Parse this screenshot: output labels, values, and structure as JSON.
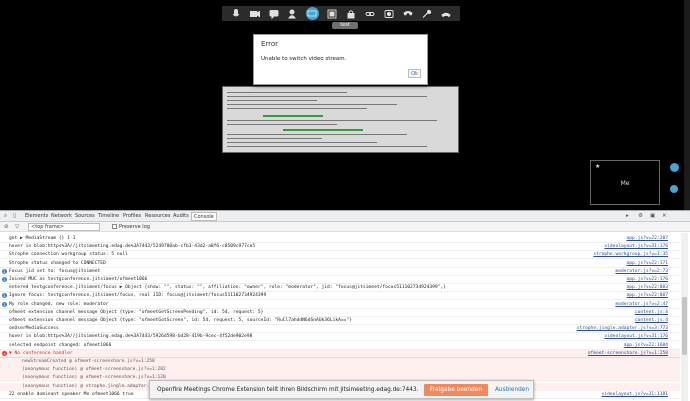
{
  "video": {
    "subject": "test",
    "local_name": "Me",
    "toolbar_icons": [
      "mic-icon",
      "camera-icon",
      "chat-icon",
      "add-user-icon",
      "desktop-share-icon",
      "fullscreen-icon",
      "lock-icon",
      "link-icon",
      "record-icon",
      "phone-icon",
      "settings-icon",
      "hangup-icon"
    ]
  },
  "dialog": {
    "title": "Error",
    "message": "Unable to switch video stream.",
    "ok_label": "Ok"
  },
  "devtools": {
    "tabs": [
      "Elements",
      "Network",
      "Sources",
      "Timeline",
      "Profiles",
      "Resources",
      "Audits",
      "Console"
    ],
    "active_tab": "Console",
    "frame_selector": "<top frame>",
    "preserve_log": "Preserve log",
    "rows": [
      {
        "msg": "got ▶ MediaStream {}  1 1",
        "src": "app.js?v=22:207"
      },
      {
        "msg": "hover in blob:https%3A//jitsimeeting.edag.de%3A7443/5249780ab-cfb3-43d2-a8f6-c8509c977ce5",
        "src": "videolayout.js?v=31:176"
      },
      {
        "msg": "Strophe connection workgroup status:  5 null",
        "src": "strophe.workgroup.js?v=1:35"
      },
      {
        "msg": "Strophe status changed to CONNECTED",
        "src": "app.js?v=22:171"
      },
      {
        "msg": "Focus jid set to: focus@jitsimeet",
        "src": "moderator.js?v=2:73",
        "info": true
      },
      {
        "msg": "Joined MUC as testgconference.jitsimeet/ofmeet1066",
        "src": "app.js?v=22:176",
        "info": true
      },
      {
        "msg": "entered testgconference.jitsimeet/focus ▶ Object {show: \"\", status: \"\", affiliation: \"owner\", role: \"moderator\", jid: \"focus@jitsimeet/focus511102734924399\",}",
        "src": "app.js?v=22:803"
      },
      {
        "msg": "Ignore focus: testgconference.jitsimeet/focus, real JID: focus@jitsimeet/focus511102734924399",
        "src": "app.js?v=22:807",
        "info": true
      },
      {
        "msg": "My role changed, new role: moderator",
        "src": "moderator.js?v=2:47",
        "info": true
      },
      {
        "msg": "ofmeet extension channel message Object {type: \"ofmeetGetScreenPending\", id: 54, request: 5}",
        "src": "content.js:4"
      },
      {
        "msg": "ofmeet extension channel message Object {type: \"ofmeetGotScreen\", id: 54, request: 5, sourceId: \"RuCl7ahddN6dSnAUk36LikA==\"}",
        "src": "content.js:4"
      },
      {
        "msg": "onUserMediaSuccess",
        "src": "strophe.jingle.adapter.js?v=3:773"
      },
      {
        "msg": "hover in blob:https%3A//jitsimeeting.edag.de%3A7443/5926d598-bd28-419b-9cec-4f52de902e98",
        "src": "videolayout.js?v=31:176"
      },
      {
        "msg": "selected endpoint changed:  ofmeet1066",
        "src": "app.js?v=22:1684"
      }
    ],
    "error": {
      "msg": "▼ No conference handler",
      "src": "ofmeet-screenshare.js?v=1:258",
      "stack": [
        {
          "msg": "newStreamCreated      @ ofmeet-screenshare.js?v=1:258"
        },
        {
          "msg": "(anonymous function) @ ofmeet-screenshare.js?v=1:282"
        },
        {
          "msg": "(anonymous function) @ ofmeet-screenshare.js?v=1:120"
        },
        {
          "msg": "(anonymous function) @ strophe.jingle.adapter.js?v=3:774"
        }
      ]
    },
    "last_row": {
      "msg": "22 enable dominant speaker Me ofmeet1066 true",
      "src": "videolayout.js?v=31:1181"
    }
  },
  "notification": {
    "text": "Openfire Meetings Chrome Extension teilt Ihren Bildschirm mit jitsimeeting.edag.de:7443.",
    "accept_label": "Freigabe beenden",
    "hide_label": "Ausblenden"
  },
  "colors": {
    "accent_blue": "#3fa6d9",
    "accept_orange": "#ef8a5f",
    "error_red": "#e23b3b"
  }
}
